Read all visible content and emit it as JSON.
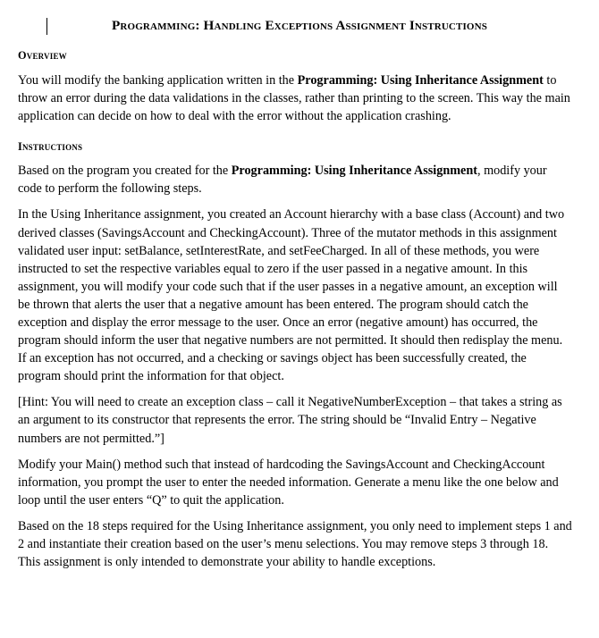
{
  "document": {
    "title": "Programming: Handling Exceptions Assignment Instructions",
    "caret_visible": true,
    "background_color": "#ffffff",
    "text_color": "#000000"
  },
  "sections": {
    "overview": {
      "heading": "Overview",
      "paragraph": {
        "part1": "You will modify the banking application written in the ",
        "bold1": "Programming: Using Inheritance Assignment",
        "part2": " to throw an error during the data validations in the classes, rather than printing to the screen.  This way the main application can decide on how to deal with the error without the application crashing."
      }
    },
    "instructions": {
      "heading": "Instructions",
      "paragraph1": {
        "part1": "Based on the program you created for the ",
        "bold1": "Programming: Using Inheritance Assignment",
        "part2": ", modify your code to perform the following steps."
      },
      "paragraph2": "In the Using Inheritance assignment, you created an Account hierarchy with a base class (Account) and two derived classes (SavingsAccount and CheckingAccount).  Three of the mutator methods in this assignment validated user input:  setBalance, setInterestRate, and setFeeCharged.  In all of these methods, you were instructed to set the respective variables equal to zero if the user passed in a negative amount.  In this assignment, you will modify your code such that if the user passes in a negative amount, an exception will be thrown that alerts the user that a negative amount has been entered.  The program should catch the exception and display the error message to the user.  Once an error (negative amount) has occurred, the program should inform the user that negative numbers are not permitted.  It should then redisplay the menu.   If an exception has not occurred, and a checking or savings object has been successfully created, the program should print the information for that object.",
      "paragraph3": "[Hint:  You will need to create an exception class – call it NegativeNumberException – that takes a string as an argument to its constructor that represents the error.  The string should be “Invalid Entry – Negative numbers are not permitted.”]",
      "paragraph4": "Modify your Main() method such that instead of hardcoding the SavingsAccount and CheckingAccount information, you prompt the user to enter the needed information.  Generate a menu like the one below and loop until the user enters “Q” to quit the application.",
      "paragraph5": "Based on the 18 steps required for the Using Inheritance assignment, you only need to implement steps 1 and 2 and instantiate their creation based on the user’s menu selections.  You may remove steps 3 through 18.  This assignment is only intended to demonstrate your ability to handle exceptions."
    }
  }
}
